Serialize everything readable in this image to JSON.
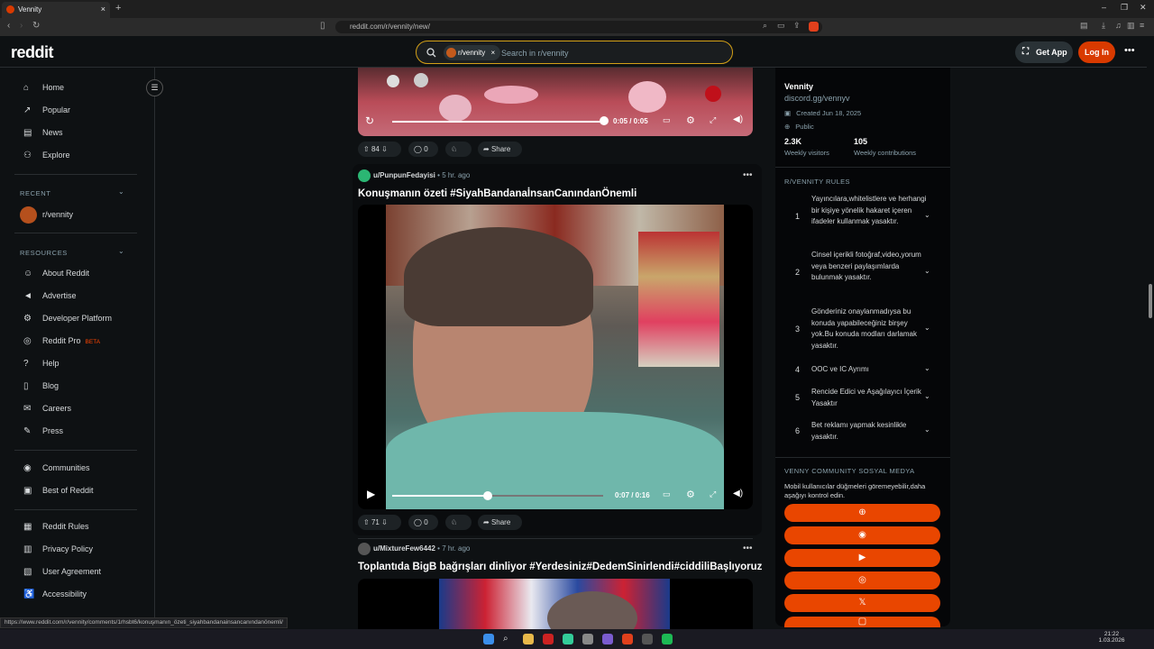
{
  "browser": {
    "tab_title": "Vennity",
    "url": "reddit.com/r/vennity/new/",
    "status_url": "https://www.reddit.com/r/vennity/comments/1rhsbt6/konuşmanın_özeti_siyahbandanainsancanındanönemli/"
  },
  "header": {
    "logo": "reddit",
    "search_chip": "r/vennity",
    "search_placeholder": "Search in r/vennity",
    "get_app": "Get App",
    "login": "Log In"
  },
  "leftnav": {
    "main": [
      {
        "label": "Home",
        "icon": "home-icon"
      },
      {
        "label": "Popular",
        "icon": "popular-icon"
      },
      {
        "label": "News",
        "icon": "news-icon"
      },
      {
        "label": "Explore",
        "icon": "explore-icon"
      }
    ],
    "recent_header": "RECENT",
    "recent": [
      {
        "label": "r/vennity"
      }
    ],
    "resources_header": "RESOURCES",
    "resources": [
      {
        "label": "About Reddit"
      },
      {
        "label": "Advertise"
      },
      {
        "label": "Developer Platform"
      },
      {
        "label": "Reddit Pro",
        "badge": "BETA"
      },
      {
        "label": "Help"
      },
      {
        "label": "Blog"
      },
      {
        "label": "Careers"
      },
      {
        "label": "Press"
      }
    ],
    "community": [
      {
        "label": "Communities"
      },
      {
        "label": "Best of Reddit"
      }
    ],
    "legal": [
      {
        "label": "Reddit Rules"
      },
      {
        "label": "Privacy Policy"
      },
      {
        "label": "User Agreement"
      },
      {
        "label": "Accessibility"
      }
    ]
  },
  "posts": [
    {
      "video_time": "0:05 / 0:05",
      "progress": 1.0,
      "votes": "84",
      "comments": "0",
      "share": "Share"
    },
    {
      "author": "u/PunpunFedayisi",
      "age": "5 hr. ago",
      "title": "Konuşmanın özeti #SiyahBandanaİnsanCanındanÖnemli",
      "video_time": "0:07 / 0:16",
      "progress": 0.44,
      "votes": "71",
      "comments": "0",
      "share": "Share"
    },
    {
      "author": "u/MixtureFew6442",
      "age": "7 hr. ago",
      "title": "Toplantıda BigB bağrışları dinliyor #Yerdesiniz#DedemSinirlendi#ciddiliBaşlıyoruz"
    }
  ],
  "sidebar": {
    "name": "Vennity",
    "link": "discord.gg/vennyv",
    "created": "Created Jun 18, 2025",
    "visibility": "Public",
    "visitors_value": "2.3K",
    "visitors_label": "Weekly visitors",
    "contrib_value": "105",
    "contrib_label": "Weekly contributions",
    "rules_header": "R/VENNITY RULES",
    "rules": [
      {
        "n": "1",
        "text": "Yayıncılara,whitelistlere ve herhangi bir kişiye yönelik hakaret içeren ifadeler kullanmak yasaktır."
      },
      {
        "n": "2",
        "text": "Cinsel içerikli fotoğraf,video,yorum veya benzeri paylaşımlarda bulunmak yasaktır."
      },
      {
        "n": "3",
        "text": "Gönderiniz onaylanmadıysa bu konuda yapabileceğiniz birşey yok.Bu konuda modları darlamak yasaktır."
      },
      {
        "n": "4",
        "text": "OOC ve IC Ayrımı"
      },
      {
        "n": "5",
        "text": "Rencide Edici ve Aşağılayıcı İçerik Yasaktır"
      },
      {
        "n": "6",
        "text": "Bet reklamı yapmak kesinlikle yasaktır."
      }
    ],
    "social_header": "VENNY COMMUNITY SOSYAL MEDYA",
    "social_desc": "Mobil kullanıcılar düğmeleri göremeyebilir,daha aşağıyı kontrol edin.",
    "social_buttons": [
      "globe-icon",
      "discord-icon",
      "youtube-icon",
      "instagram-icon",
      "x-icon",
      "twitch-icon"
    ]
  },
  "taskbar": {
    "time": "21:22",
    "date": "1.03.2026"
  }
}
